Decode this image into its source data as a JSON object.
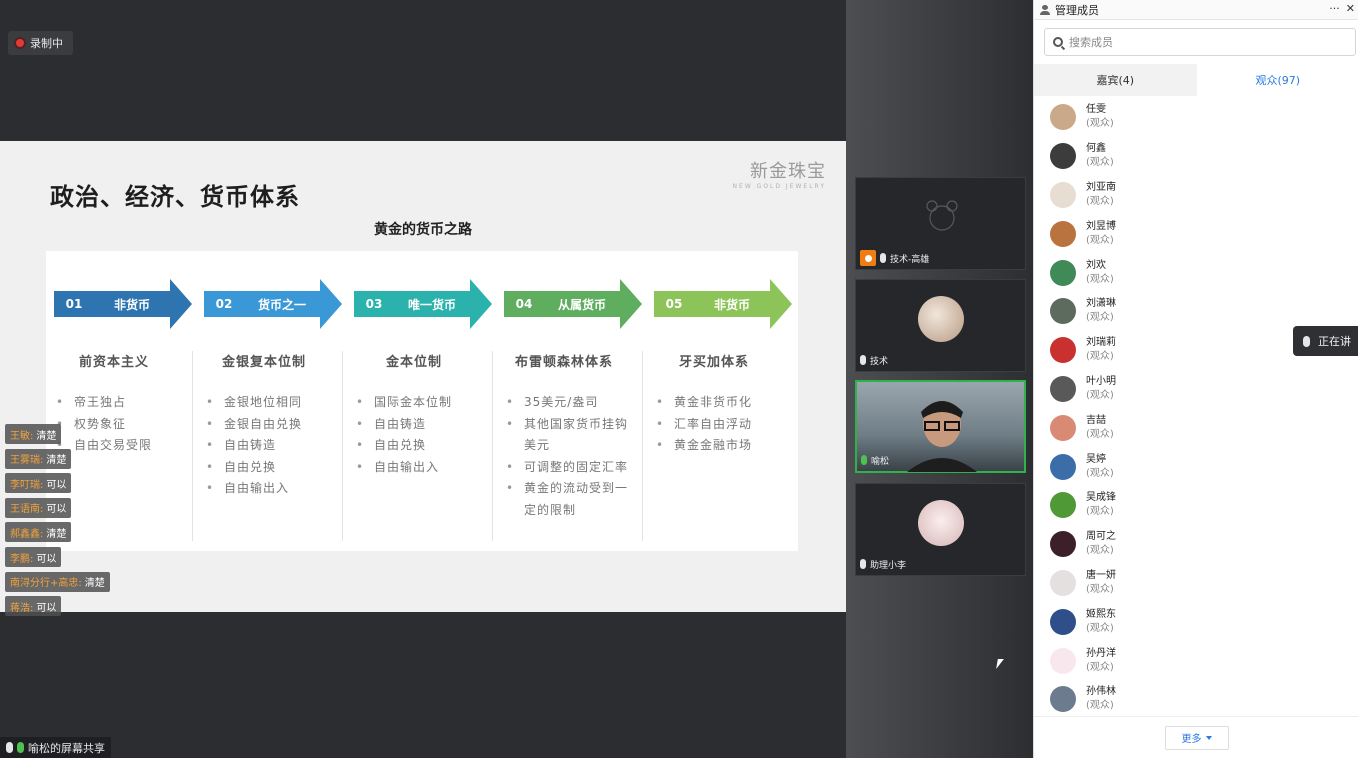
{
  "recording": {
    "label": "录制中"
  },
  "slide": {
    "title": "政治、经济、货币体系",
    "brand": "新金珠宝",
    "brand_sub": "NEW GOLD JEWELRY",
    "subtitle": "黄金的货币之路",
    "stages": [
      {
        "num": "01",
        "label": "非货币",
        "color": "#2d74b0",
        "heading": "前资本主义",
        "points": [
          "帝王独占",
          "权势象征",
          "自由交易受限"
        ]
      },
      {
        "num": "02",
        "label": "货币之一",
        "color": "#3b98d6",
        "heading": "金银复本位制",
        "points": [
          "金银地位相同",
          "金银自由兑换",
          "自由铸造",
          "自由兑换",
          "自由输出入"
        ]
      },
      {
        "num": "03",
        "label": "唯一货币",
        "color": "#2bb2ad",
        "heading": "金本位制",
        "points": [
          "国际金本位制",
          "自由铸造",
          "自由兑换",
          "自由输出入"
        ]
      },
      {
        "num": "04",
        "label": "从属货币",
        "color": "#5fae5f",
        "heading": "布雷顿森林体系",
        "points": [
          "35美元/盎司",
          "其他国家货币挂钩美元",
          "可调整的固定汇率",
          "黄金的流动受到一定的限制"
        ]
      },
      {
        "num": "05",
        "label": "非货币",
        "color": "#8cc45a",
        "heading": "牙买加体系",
        "points": [
          "黄金非货币化",
          "汇率自由浮动",
          "黄金金融市场"
        ]
      }
    ]
  },
  "chat_messages": [
    {
      "name": "王敏:",
      "text": "清楚"
    },
    {
      "name": "王雾瑞:",
      "text": "清楚"
    },
    {
      "name": "李叮瑞:",
      "text": "可以"
    },
    {
      "name": "王语南:",
      "text": "可以"
    },
    {
      "name": "郝鑫鑫:",
      "text": "清楚"
    },
    {
      "name": "李鹏:",
      "text": "可以"
    },
    {
      "name": "南浔分行+高忠:",
      "text": "清楚"
    },
    {
      "name": "蒋浩:",
      "text": "可以"
    }
  ],
  "share_label": "喻松的屏幕共享",
  "video_tiles": [
    {
      "name": "技术-高雄"
    },
    {
      "name": "技术"
    },
    {
      "name": "喻松"
    },
    {
      "name": "助理小李"
    }
  ],
  "members_panel": {
    "title": "管理成员",
    "search_placeholder": "搜索成员",
    "tab_guests": "嘉宾(4)",
    "tab_audience": "观众(97)",
    "more_label": "更多",
    "speaking_label": "正在讲",
    "members": [
      {
        "name": "任雯",
        "role": "(观众)",
        "color": "#c9a98a"
      },
      {
        "name": "何鑫",
        "role": "(观众)",
        "color": "#3c3c3c"
      },
      {
        "name": "刘亚南",
        "role": "(观众)",
        "color": "#e8ddd2"
      },
      {
        "name": "刘昱博",
        "role": "(观众)",
        "color": "#b8733e"
      },
      {
        "name": "刘欢",
        "role": "(观众)",
        "color": "#3f8a57"
      },
      {
        "name": "刘潇琳",
        "role": "(观众)",
        "color": "#5d6b5e"
      },
      {
        "name": "刘瑞莉",
        "role": "(观众)",
        "color": "#c8312f"
      },
      {
        "name": "叶小明",
        "role": "(观众)",
        "color": "#595959"
      },
      {
        "name": "吉喆",
        "role": "(观众)",
        "color": "#d98a74"
      },
      {
        "name": "吴婷",
        "role": "(观众)",
        "color": "#3b6ea8"
      },
      {
        "name": "吴成锋",
        "role": "(观众)",
        "color": "#4f9a36"
      },
      {
        "name": "周可之",
        "role": "(观众)",
        "color": "#3d1f2a"
      },
      {
        "name": "唐一妍",
        "role": "(观众)",
        "color": "#e5e0e0"
      },
      {
        "name": "姬熙东",
        "role": "(观众)",
        "color": "#2e4f8a"
      },
      {
        "name": "孙丹洋",
        "role": "(观众)",
        "color": "#f8e8ee"
      },
      {
        "name": "孙伟林",
        "role": "(观众)",
        "color": "#6c7c8e"
      }
    ]
  }
}
